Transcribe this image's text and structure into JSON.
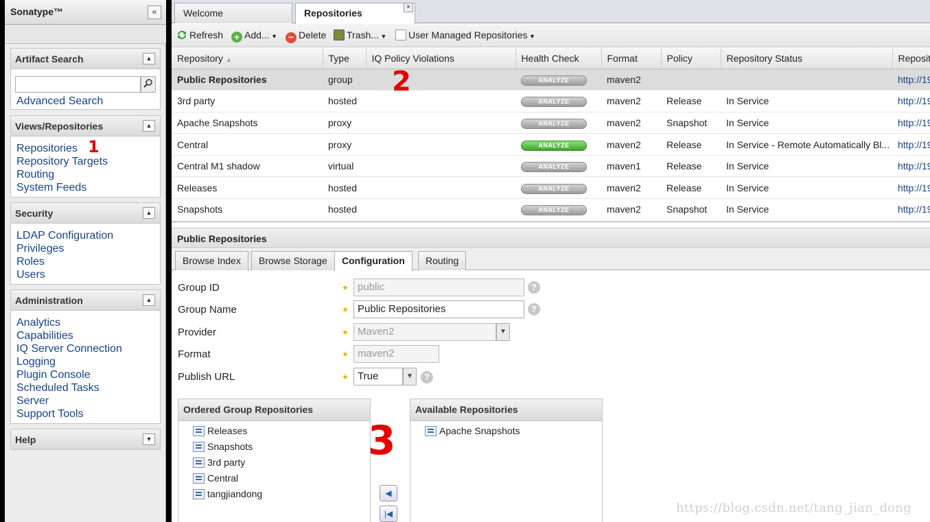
{
  "sidebar": {
    "brand": "Sonatype™",
    "collapse_glyph": "«",
    "artifact_search": {
      "title": "Artifact Search",
      "search_placeholder": "",
      "advanced": "Advanced Search"
    },
    "views": {
      "title": "Views/Repositories",
      "items": [
        "Repositories",
        "Repository Targets",
        "Routing",
        "System Feeds"
      ]
    },
    "security": {
      "title": "Security",
      "items": [
        "LDAP Configuration",
        "Privileges",
        "Roles",
        "Users"
      ]
    },
    "administration": {
      "title": "Administration",
      "items": [
        "Analytics",
        "Capabilities",
        "IQ Server Connection",
        "Logging",
        "Plugin Console",
        "Scheduled Tasks",
        "Server",
        "Support Tools"
      ]
    },
    "help": {
      "title": "Help"
    }
  },
  "tabs": {
    "welcome": "Welcome",
    "repositories": "Repositories",
    "close_glyph": "×"
  },
  "toolbar": {
    "refresh": "Refresh",
    "add": "Add...",
    "delete": "Delete",
    "trash": "Trash...",
    "user_managed": "User Managed Repositories"
  },
  "grid": {
    "columns": [
      "Repository",
      "Type",
      "IQ Policy Violations",
      "Health Check",
      "Format",
      "Policy",
      "Repository Status",
      "Repository Path"
    ],
    "sort_glyph": "▲",
    "analyze_label": "ANALYZE",
    "rows": [
      {
        "name": "Public Repositories",
        "type": "group",
        "iq": "",
        "health": "gray",
        "format": "maven2",
        "policy": "",
        "status": "",
        "url": "http://19"
      },
      {
        "name": "3rd party",
        "type": "hosted",
        "iq": "",
        "health": "gray",
        "format": "maven2",
        "policy": "Release",
        "status": "In Service",
        "url": "http://19"
      },
      {
        "name": "Apache Snapshots",
        "type": "proxy",
        "iq": "",
        "health": "gray",
        "format": "maven2",
        "policy": "Snapshot",
        "status": "In Service",
        "url": "http://19"
      },
      {
        "name": "Central",
        "type": "proxy",
        "iq": "",
        "health": "green",
        "format": "maven2",
        "policy": "Release",
        "status": "In Service - Remote Automatically Bl...",
        "url": "http://19"
      },
      {
        "name": "Central M1 shadow",
        "type": "virtual",
        "iq": "",
        "health": "gray",
        "format": "maven1",
        "policy": "Release",
        "status": "In Service",
        "url": "http://19"
      },
      {
        "name": "Releases",
        "type": "hosted",
        "iq": "",
        "health": "gray",
        "format": "maven2",
        "policy": "Release",
        "status": "In Service",
        "url": "http://19"
      },
      {
        "name": "Snapshots",
        "type": "hosted",
        "iq": "",
        "health": "gray",
        "format": "maven2",
        "policy": "Snapshot",
        "status": "In Service",
        "url": "http://19"
      }
    ]
  },
  "detail": {
    "title": "Public Repositories",
    "tabs": [
      "Browse Index",
      "Browse Storage",
      "Configuration",
      "Routing"
    ],
    "active_tab": "Configuration",
    "fields": {
      "group_id": {
        "label": "Group ID",
        "value": "public"
      },
      "group_name": {
        "label": "Group Name",
        "value": "Public Repositories"
      },
      "provider": {
        "label": "Provider",
        "value": "Maven2"
      },
      "format": {
        "label": "Format",
        "value": "maven2"
      },
      "publish_url": {
        "label": "Publish URL",
        "value": "True"
      }
    },
    "help_glyph": "?",
    "ordered": {
      "title": "Ordered Group Repositories",
      "items": [
        "Releases",
        "Snapshots",
        "3rd party",
        "Central",
        "tangjiandong"
      ]
    },
    "available": {
      "title": "Available Repositories",
      "items": [
        "Apache Snapshots"
      ]
    },
    "arrow_left": "◀",
    "arrow_first": "|◀"
  },
  "annotations": [
    "1",
    "2",
    "3"
  ],
  "watermark": "https://blog.csdn.net/tang_jian_dong",
  "colors": {
    "link": "#15428b",
    "annotation": "#e60000",
    "analyze_green": "#3da52b"
  }
}
